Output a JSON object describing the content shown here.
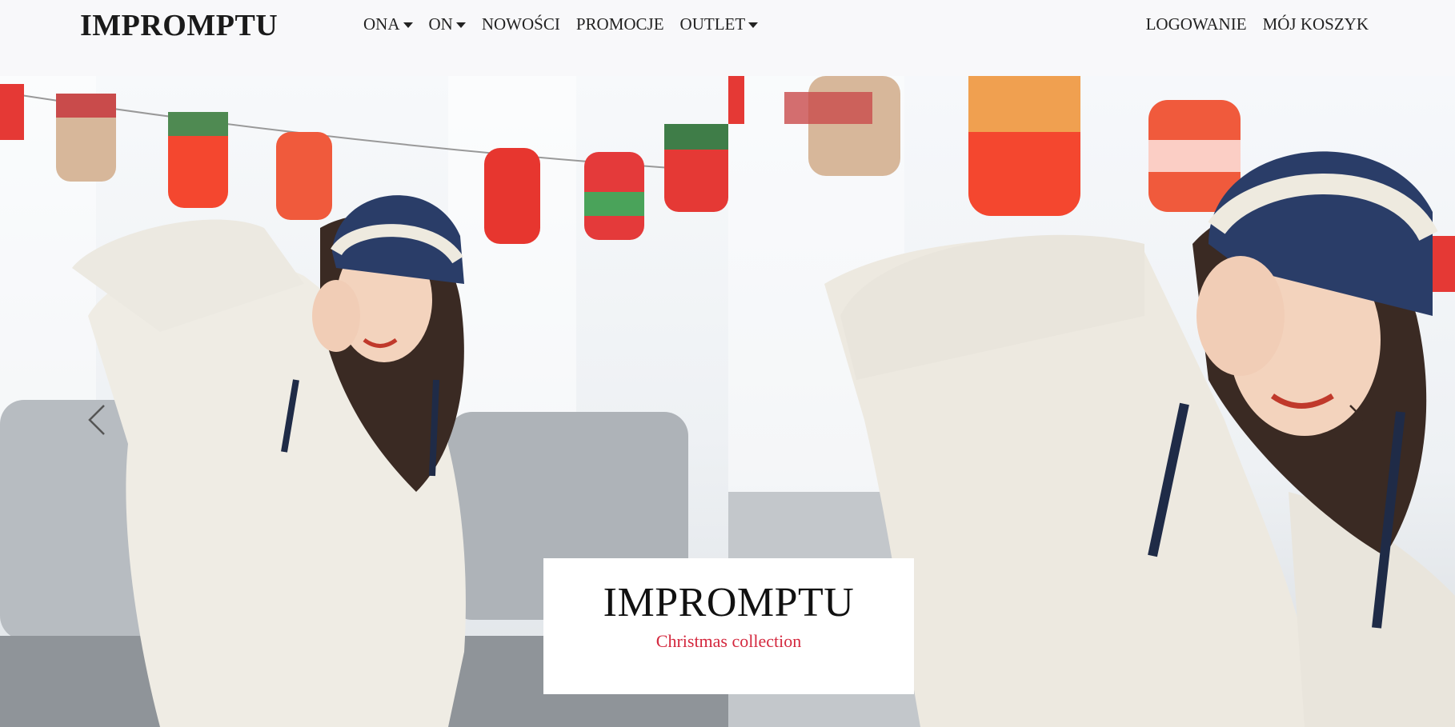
{
  "brand": {
    "name": "IMPROMPTU"
  },
  "nav": {
    "left": [
      {
        "label": "ONA",
        "dropdown": true
      },
      {
        "label": "ON",
        "dropdown": true
      },
      {
        "label": "NOWOŚCI",
        "dropdown": false
      },
      {
        "label": "PROMOCJE",
        "dropdown": false
      },
      {
        "label": "OUTLET",
        "dropdown": true
      }
    ],
    "right": [
      {
        "label": "LOGOWANIE"
      },
      {
        "label": "MÓJ KOSZYK"
      }
    ]
  },
  "hero": {
    "caption_title": "IMPROMPTU",
    "caption_subtitle": "Christmas collection",
    "prev_icon": "chevron-left-icon",
    "next_icon": "chevron-right-icon"
  },
  "colors": {
    "accent_red": "#d4283e",
    "navbar_bg": "#f8f8fa",
    "text": "#222222"
  }
}
